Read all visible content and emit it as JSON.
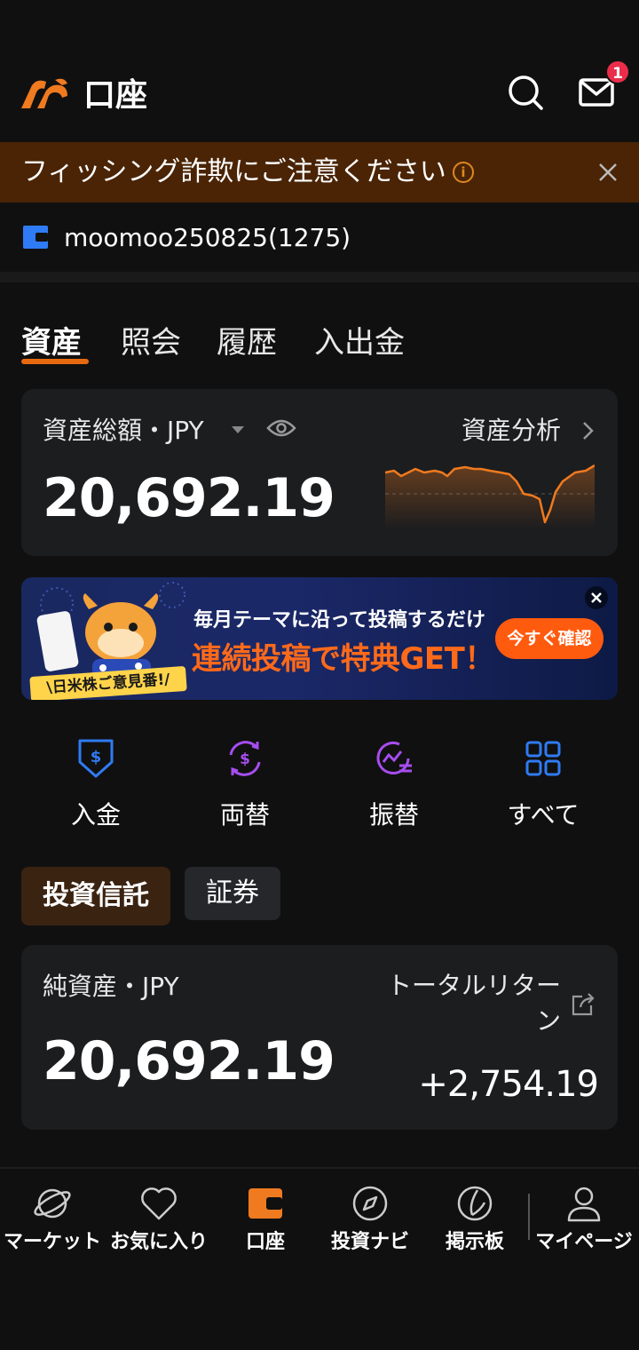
{
  "header": {
    "title": "口座",
    "notification_count": "1"
  },
  "phishing_banner": {
    "text": "フィッシング詐欺にご注意ください",
    "info_glyph": "i"
  },
  "account": {
    "id": "moomoo250825(1275)"
  },
  "tabs": [
    {
      "label": "資産"
    },
    {
      "label": "照会"
    },
    {
      "label": "履歴"
    },
    {
      "label": "入出金"
    }
  ],
  "asset_summary": {
    "label": "資産総額・JPY",
    "analysis_link": "資産分析",
    "total": "20,692.19",
    "sparkline_color": "#f07a1f"
  },
  "promo": {
    "line1": "毎月テーマに沿って投稿するだけ",
    "line2": "連続投稿で特典GET！",
    "button": "今すぐ確認",
    "stamp": "\\日米株ご意見番!/"
  },
  "quick_actions": [
    {
      "label": "入金",
      "icon": "deposit-icon"
    },
    {
      "label": "両替",
      "icon": "exchange-icon"
    },
    {
      "label": "振替",
      "icon": "transfer-icon"
    },
    {
      "label": "すべて",
      "icon": "grid-icon"
    }
  ],
  "segments": [
    {
      "label": "投資信託"
    },
    {
      "label": "証券"
    }
  ],
  "fund_summary": {
    "label": "純資産・JPY",
    "value": "20,692.19",
    "return_label_line1": "トータルリター",
    "return_label_line2": "ン",
    "return_value": "+2,754.19"
  },
  "bottom_nav": [
    {
      "label": "マーケット",
      "icon": "planet-icon"
    },
    {
      "label": "お気に入り",
      "icon": "heart-icon"
    },
    {
      "label": "口座",
      "icon": "wallet-icon"
    },
    {
      "label": "投資ナビ",
      "icon": "compass-icon"
    },
    {
      "label": "掲示板",
      "icon": "forum-icon"
    },
    {
      "label": "マイページ",
      "icon": "person-icon"
    }
  ],
  "colors": {
    "accent": "#f07a1f",
    "blue": "#2f7bf5",
    "purple": "#a64df0"
  }
}
